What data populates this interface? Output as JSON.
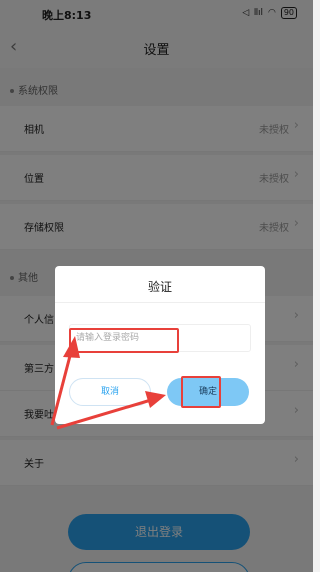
{
  "status_bar": {
    "time": "晚上8:13",
    "signal": "⫴ıl",
    "battery": "90"
  },
  "nav": {
    "title": "设置"
  },
  "sections": {
    "permissions": {
      "header": "系统权限",
      "items": [
        {
          "label": "相机",
          "value": "未授权"
        },
        {
          "label": "位置",
          "value": "未授权"
        },
        {
          "label": "存储权限",
          "value": "未授权"
        }
      ]
    },
    "other": {
      "header": "其他",
      "items": [
        {
          "label": "个人信"
        },
        {
          "label": "第三方"
        },
        {
          "label": "我要吐"
        },
        {
          "label": "关于"
        }
      ]
    }
  },
  "logout": {
    "label": "退出登录"
  },
  "dialog": {
    "title": "验证",
    "password_placeholder": "请输入登录密码",
    "cancel_label": "取消",
    "confirm_label": "确定"
  },
  "colors": {
    "accent": "#2aa3ef",
    "annotation": "#e8403a"
  }
}
